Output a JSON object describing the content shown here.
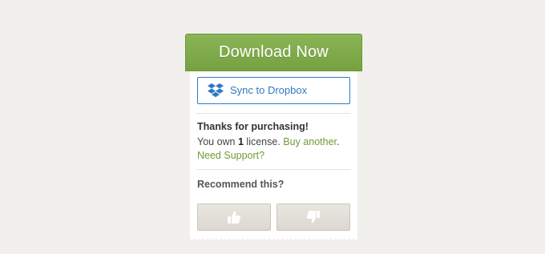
{
  "download": {
    "label": "Download Now"
  },
  "dropbox": {
    "label": "Sync to Dropbox",
    "icon": "dropbox-icon"
  },
  "purchase": {
    "thanks": "Thanks for purchasing!",
    "own_prefix": "You own",
    "count": "1",
    "own_suffix": "license.",
    "buy_another": "Buy another",
    "period": ".",
    "support": "Need Support?"
  },
  "recommend": {
    "title": "Recommend this?",
    "up_icon": "thumbs-up-icon",
    "down_icon": "thumbs-down-icon"
  },
  "colors": {
    "accent_green": "#7aa545",
    "link_green": "#6f9c38",
    "dropbox_blue": "#2f78c4",
    "background": "#f1f0ec"
  }
}
